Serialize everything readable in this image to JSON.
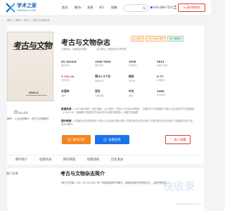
{
  "header": {
    "logo_cn": "学术之家",
    "logo_en": "XUESHU.COM",
    "nav": [
      "首页",
      "期刊",
      "发表",
      "SCI",
      "投稿"
    ],
    "search_placeholder": "",
    "phone": "400-888-7501",
    "cart": "我的购物车"
  },
  "breadcrumb": "首页 > 期刊 > 考古 > 考古与文物杂志",
  "journal": {
    "title": "考古与文物杂志",
    "cover_title": "考古与文物",
    "cover_issue": "2024.4",
    "meta_left": "主管单位：陕西省文物局",
    "meta_right": "主办单位：陕西省考古研究院",
    "badges": [
      "北大期刊",
      "CSSCI南大期刊",
      "统计源期刊"
    ],
    "zoom": "加入对比",
    "tagline": "期刊 · 人文社科期刊 · 考古与文物期刊"
  },
  "stats": [
    {
      "value": "61-1010/K",
      "label": "国内刊号"
    },
    {
      "value": "1000-7830",
      "label": "国际刊号"
    },
    {
      "value": "1096",
      "label": "影响因子"
    },
    {
      "value": "9613",
      "label": "总被引次数"
    },
    {
      "value": "¥ 240.00",
      "label": "全年定价"
    },
    {
      "value": "预计1-3个月",
      "label": "审稿时间"
    },
    {
      "value": "陕西",
      "label": "所在地"
    },
    {
      "value": "0.77",
      "label": "影响因子"
    },
    {
      "value": "多语种",
      "label": "语种"
    },
    {
      "value": "双月",
      "label": "出版周期"
    },
    {
      "value": "中文",
      "label": "语言"
    },
    {
      "value": "1980",
      "label": "创刊时间"
    }
  ],
  "info_blocks": [
    {
      "heading": "数据来源：",
      "text": "CSSCI南大期刊（含扩展版） 北大期刊（中国人文社会科学期刊） 中国科学引文数据库 中国人文社会科学引文数据库（CHSSCD） 普通期刊 国家哲学社会科学学术期刊数据库 上海图书馆馆藏"
    },
    {
      "heading": "期刊荣誉：",
      "text": "中国期刊方阵双效期刊 中国人文社会科学核心期刊 中国百种杰出学术期刊 中国优秀社科学术期刊 中国国际影响力优秀学术期刊"
    }
  ],
  "buttons": {
    "subscribe": "期刊订阅",
    "consult": "投稿咨询",
    "favorite": "加入收藏"
  },
  "tabs": [
    "期刊简介",
    "往期目录",
    "期刊荣誉",
    "投稿须知",
    "历史收录"
  ],
  "section": {
    "side": "热门文章",
    "title": "考古与文物杂志简介",
    "text": "《考古与文物》（CN：61-1010/K）是一份高质量的学术期刊，由陕西省考古研究院主办，主要刊登考古..."
  },
  "watermark": "快收录",
  "watermark_url": "www.kuaishoulu.com"
}
